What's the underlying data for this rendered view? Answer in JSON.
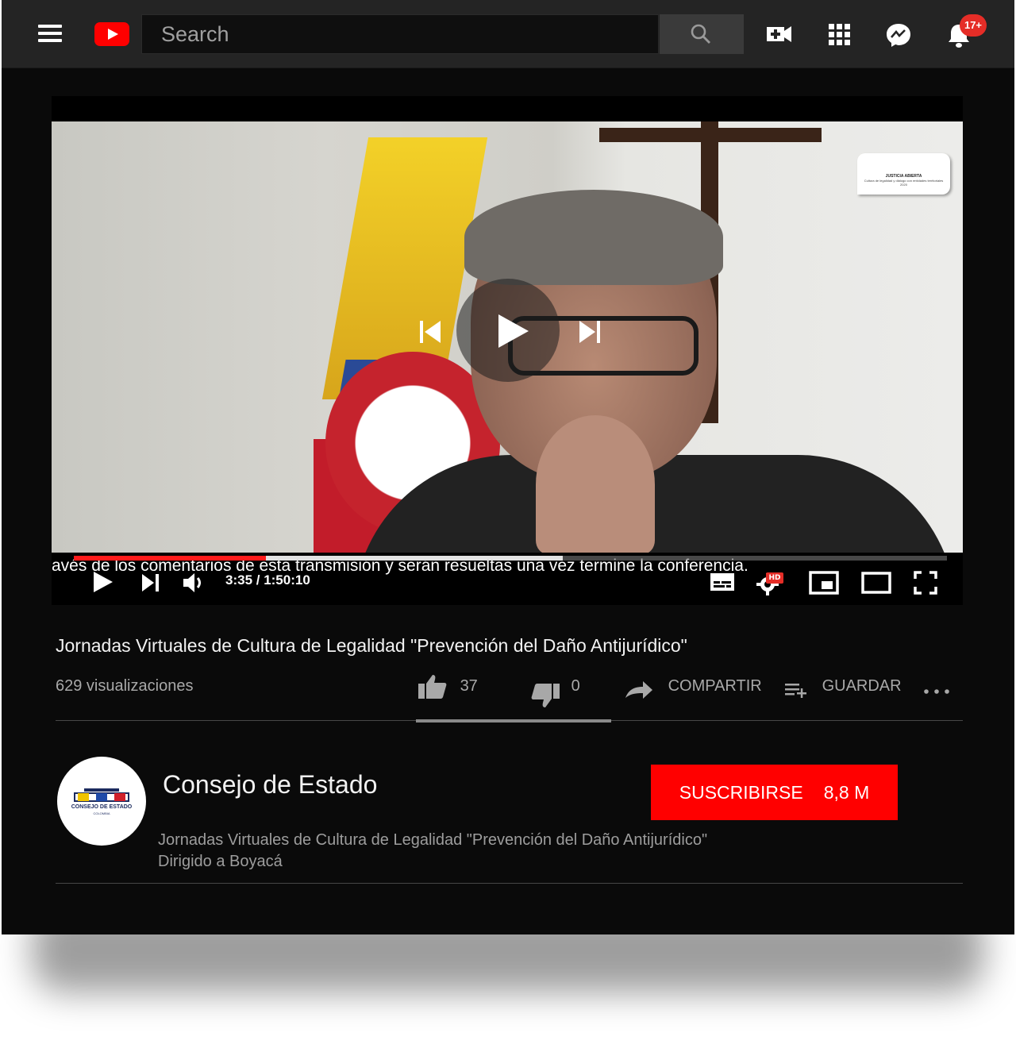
{
  "header": {
    "search_placeholder": "Search",
    "notifications_badge": "17+"
  },
  "player": {
    "caption": "avés de los comentarios de esta transmisión y serán resueltas una vez termine la conferencia.",
    "time_display": "3:35 / 1:50:10",
    "progress_played": 0.22,
    "progress_buffered": 0.56,
    "hd_label": "HD",
    "overlay_logo": {
      "title": "JUSTICIA ABIERTA",
      "subtitle": "Cultura de legalidad y diálogo con entidades territoriales",
      "year": "2020"
    }
  },
  "video": {
    "title": "Jornadas Virtuales de Cultura de Legalidad \"Prevención del Daño Antijurídico\"",
    "views": "629 visualizaciones",
    "likes": "37",
    "dislikes": "0",
    "share_label": "COMPARTIR",
    "save_label": "GUARDAR",
    "like_ratio": 1.0
  },
  "channel": {
    "name": "Consejo de Estado",
    "avatar_text": "CONSEJO DE ESTADO",
    "avatar_sub": "COLOMBIA",
    "subscribe_label": "SUSCRIBIRSE",
    "subscriber_count": "8,8 M",
    "description_line1": "Jornadas Virtuales de Cultura de Legalidad \"Prevención del Daño Antijurídico\"",
    "description_line2": "Dirigido a Boyacá"
  },
  "colors": {
    "brand_red": "#ff0000",
    "background": "#0a0a0a",
    "topbar": "#242424"
  }
}
